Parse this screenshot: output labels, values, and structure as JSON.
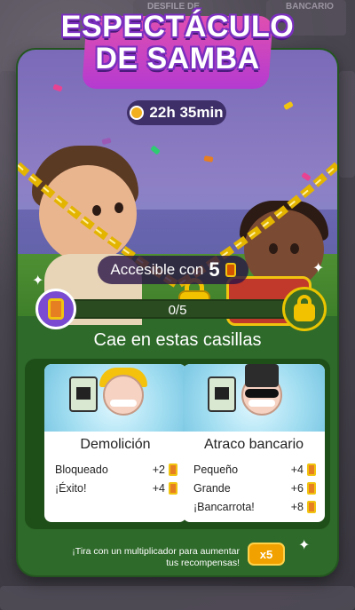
{
  "event": {
    "title_line1": "ESPECTÁCULO",
    "title_line2": "DE SAMBA",
    "timer": "22h 35min"
  },
  "unlock": {
    "prefix": "Accesible con",
    "amount": "5",
    "progress_text": "0/5",
    "progress_fraction": 0
  },
  "section": {
    "title": "Cae en estas casillas"
  },
  "cards": [
    {
      "name": "Demolición",
      "rows": [
        {
          "label": "Bloqueado",
          "value": "+2"
        },
        {
          "label": "¡Éxito!",
          "value": "+4"
        }
      ]
    },
    {
      "name": "Atraco bancario",
      "rows": [
        {
          "label": "Pequeño",
          "value": "+4"
        },
        {
          "label": "Grande",
          "value": "+6"
        },
        {
          "label": "¡Bancarrota!",
          "value": "+8"
        }
      ]
    }
  ],
  "footer": {
    "hint": "¡Tira con un multiplicador para aumentar tus recompensas!",
    "multiplier": "x5"
  },
  "background": {
    "tile_left": "DESFILE DE",
    "tile_right": "BANCARIO"
  },
  "colors": {
    "panel_green": "#2e6a2a",
    "title_purple": "#7b2fbf",
    "accent_gold": "#f2c200",
    "button_orange": "#f2a200"
  },
  "icons": {
    "timer": "stopwatch-icon",
    "token": "drum-token-icon",
    "lock": "padlock-icon"
  }
}
